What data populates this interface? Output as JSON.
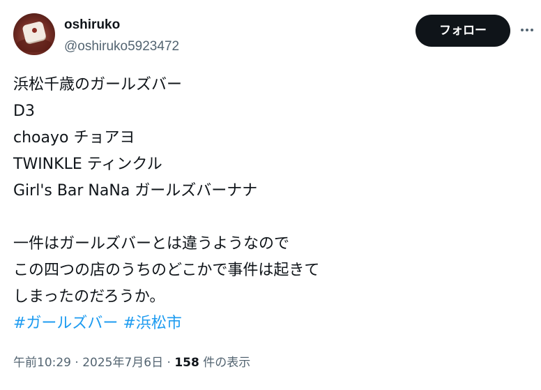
{
  "author": {
    "display_name": "oshiruko",
    "handle": "@oshiruko5923472"
  },
  "header": {
    "follow_label": "フォロー"
  },
  "tweet": {
    "lines": [
      "浜松千歳のガールズバー",
      "D3",
      "choayo チョアヨ",
      "TWINKLE ティンクル",
      "Girl's Bar NaNa ガールズバーナナ",
      "",
      "一件はガールズバーとは違うようなので",
      "この四つの店のうちのどこかで事件は起きて",
      "しまったのだろうか。"
    ],
    "hashtags": [
      "#ガールズバー",
      "#浜松市"
    ]
  },
  "meta": {
    "time": "午前10:29",
    "separator": " · ",
    "date": "2025年7月6日",
    "views_count": "158",
    "views_label": " 件の表示"
  },
  "colors": {
    "text": "#0f1419",
    "secondary": "#536471",
    "link": "#1d9bf0",
    "button_bg": "#0f1419"
  },
  "icons": {
    "more": "more-horizontal-icon"
  }
}
